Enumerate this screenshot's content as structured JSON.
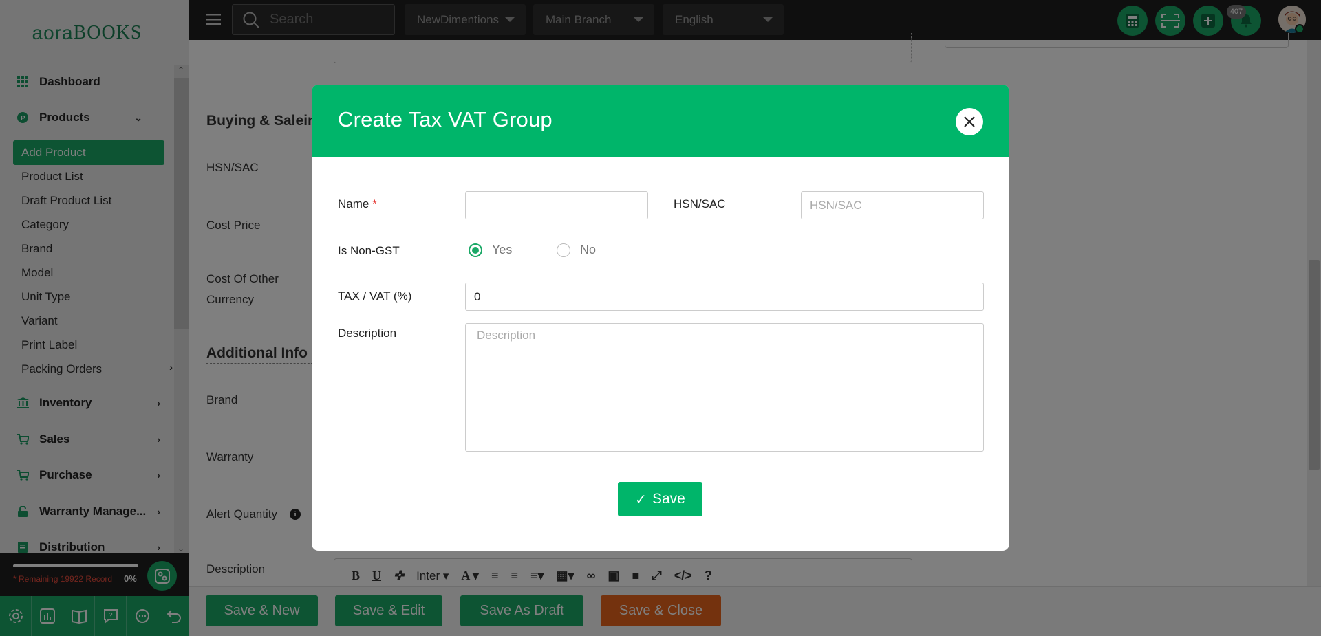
{
  "brand": {
    "logo_prefix": "aora",
    "logo_suffix": "BOOKS"
  },
  "topbar": {
    "search_placeholder": "Search",
    "company": "NewDimentions",
    "branch": "Main Branch",
    "language": "English",
    "notifications_count": "407"
  },
  "sidebar": {
    "dashboard": "Dashboard",
    "products": "Products",
    "products_items": {
      "add_product": "Add Product",
      "product_list": "Product List",
      "draft_product_list": "Draft Product List",
      "category": "Category",
      "brand": "Brand",
      "model": "Model",
      "unit_type": "Unit Type",
      "variant": "Variant",
      "print_label": "Print Label",
      "packing_orders": "Packing Orders"
    },
    "inventory": "Inventory",
    "sales": "Sales",
    "purchase": "Purchase",
    "warranty": "Warranty Manage...",
    "distribution": "Distribution",
    "remaining_records": "* Remaining 19922 Record",
    "usage_percent": "0%"
  },
  "form_bg": {
    "section_buying": "Buying & Saleing",
    "hsn_sac": "HSN/SAC",
    "cost_price": "Cost Price",
    "cost_other_line1": "Cost Of Other",
    "cost_other_line2": "Currency",
    "section_additional": "Additional Info",
    "brand": "Brand",
    "warranty": "Warranty",
    "alert_quantity": "Alert Quantity",
    "description": "Description",
    "editor_font": "Inter"
  },
  "actions": {
    "save_new": "Save & New",
    "save_edit": "Save & Edit",
    "save_draft": "Save As Draft",
    "save_close": "Save & Close"
  },
  "modal": {
    "title": "Create Tax VAT Group",
    "name_label": "Name",
    "required_mark": "*",
    "name_value": "",
    "hsn_label": "HSN/SAC",
    "hsn_placeholder": "HSN/SAC",
    "non_gst_label": "Is Non-GST",
    "yes_label": "Yes",
    "no_label": "No",
    "non_gst_selected": "Yes",
    "tax_label": "TAX / VAT (%)",
    "tax_value": "0",
    "description_label": "Description",
    "description_placeholder": "Description",
    "save_label": "Save"
  },
  "colors": {
    "accent": "#00b56a",
    "danger": "#d9601c",
    "dark": "#1e1e1e"
  }
}
